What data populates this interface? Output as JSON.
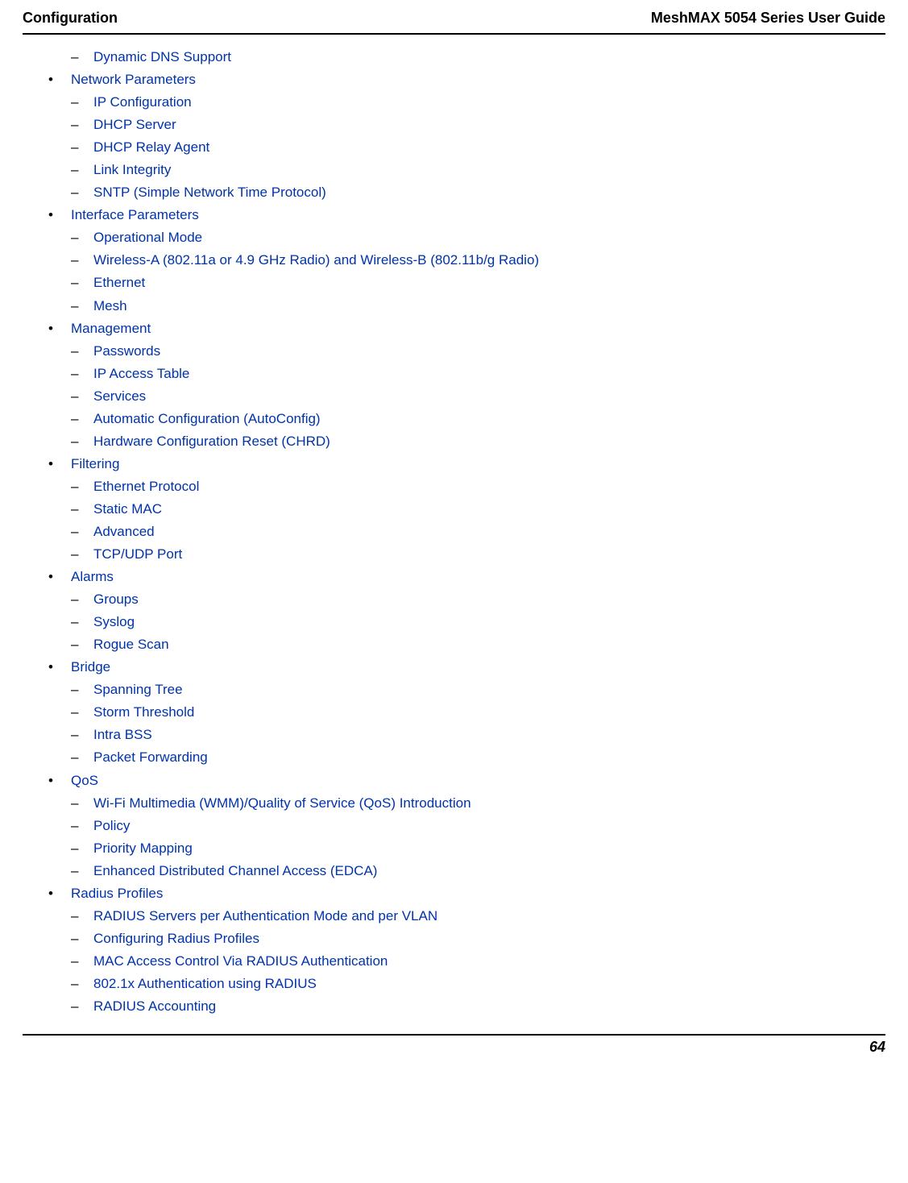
{
  "header": {
    "left": "Configuration",
    "right": "MeshMAX 5054 Series User Guide"
  },
  "orphan_sub": "Dynamic DNS Support",
  "sections": [
    {
      "label": "Network Parameters",
      "items": [
        "IP Configuration",
        "DHCP Server",
        "DHCP Relay Agent",
        "Link Integrity",
        "SNTP (Simple Network Time Protocol)"
      ]
    },
    {
      "label": "Interface Parameters",
      "items": [
        "Operational Mode",
        "Wireless-A (802.11a or 4.9 GHz Radio) and Wireless-B (802.11b/g Radio)",
        "Ethernet",
        "Mesh"
      ]
    },
    {
      "label": "Management",
      "items": [
        "Passwords",
        "IP Access Table",
        "Services",
        "Automatic Configuration (AutoConfig)",
        "Hardware Configuration Reset (CHRD)"
      ]
    },
    {
      "label": "Filtering",
      "items": [
        "Ethernet Protocol",
        "Static MAC",
        "Advanced",
        "TCP/UDP Port"
      ]
    },
    {
      "label": "Alarms",
      "items": [
        "Groups",
        "Syslog",
        "Rogue Scan"
      ]
    },
    {
      "label": "Bridge",
      "items": [
        "Spanning Tree",
        "Storm Threshold",
        "Intra BSS",
        "Packet Forwarding"
      ]
    },
    {
      "label": "QoS",
      "items": [
        "Wi-Fi Multimedia (WMM)/Quality of Service (QoS) Introduction",
        "Policy",
        "Priority Mapping",
        "Enhanced Distributed Channel Access (EDCA)"
      ]
    },
    {
      "label": "Radius Profiles",
      "items": [
        "RADIUS Servers per Authentication Mode and per VLAN",
        "Configuring Radius Profiles",
        "MAC Access Control Via RADIUS Authentication",
        "802.1x Authentication using RADIUS",
        "RADIUS Accounting"
      ]
    }
  ],
  "page_number": "64"
}
